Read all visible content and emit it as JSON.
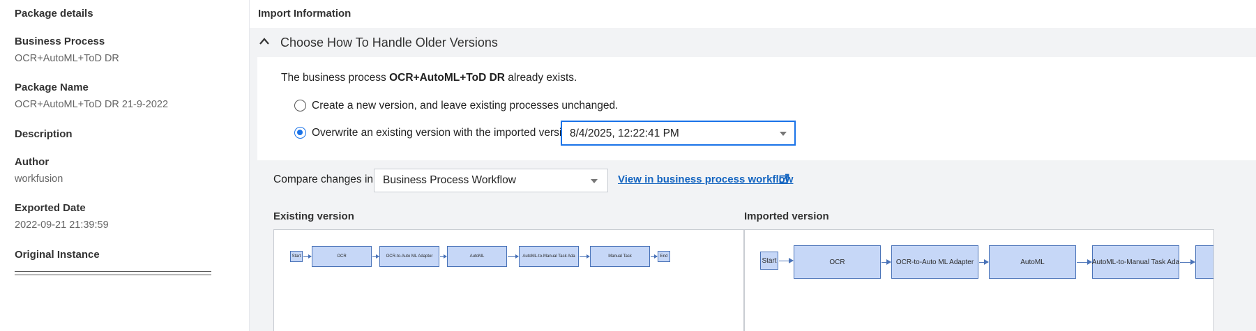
{
  "package_details": {
    "title": "Package details",
    "fields": [
      {
        "label": "Business Process",
        "value": "OCR+AutoML+ToD DR"
      },
      {
        "label": "Package Name",
        "value": "OCR+AutoML+ToD DR 21-9-2022"
      },
      {
        "label": "Description",
        "value": ""
      },
      {
        "label": "Author",
        "value": "workfusion"
      },
      {
        "label": "Exported Date",
        "value": "2022-09-21 21:39:59"
      },
      {
        "label": "Original Instance",
        "value": ""
      }
    ]
  },
  "import_info": {
    "title": "Import Information",
    "section_title": "Choose How To Handle Older Versions",
    "exists_prefix": "The business process ",
    "exists_name": "OCR+AutoML+ToD DR",
    "exists_suffix": " already exists.",
    "options": [
      {
        "label": "Create a new version, and leave existing processes  unchanged.",
        "checked": false
      },
      {
        "label": "Overwrite an existing version with the imported version.",
        "checked": true
      }
    ],
    "version_select": {
      "value": "8/4/2025, 12:22:41 PM"
    },
    "compare": {
      "label": "Compare changes in",
      "select_value": "Business Process Workflow",
      "link": "View in business process workflow",
      "link_icon": "external-link-icon"
    },
    "existing_title": "Existing version",
    "imported_title": "Imported version",
    "existing_nodes": [
      "Start",
      "OCR",
      "OCR-to-Auto ML Adapter",
      "AutoML",
      "AutoML-to-Manual Task Ada",
      "Manual Task",
      "End"
    ],
    "imported_nodes": [
      "Start",
      "OCR",
      "OCR-to-Auto ML Adapter",
      "AutoML",
      "AutoML-to-Manual Task Ada",
      ""
    ]
  },
  "colors": {
    "accent": "#1a73e8",
    "link": "#1565c0",
    "node_fill": "#c6d7f7",
    "node_border": "#4a73b8",
    "panel_bg": "#f2f3f5"
  }
}
